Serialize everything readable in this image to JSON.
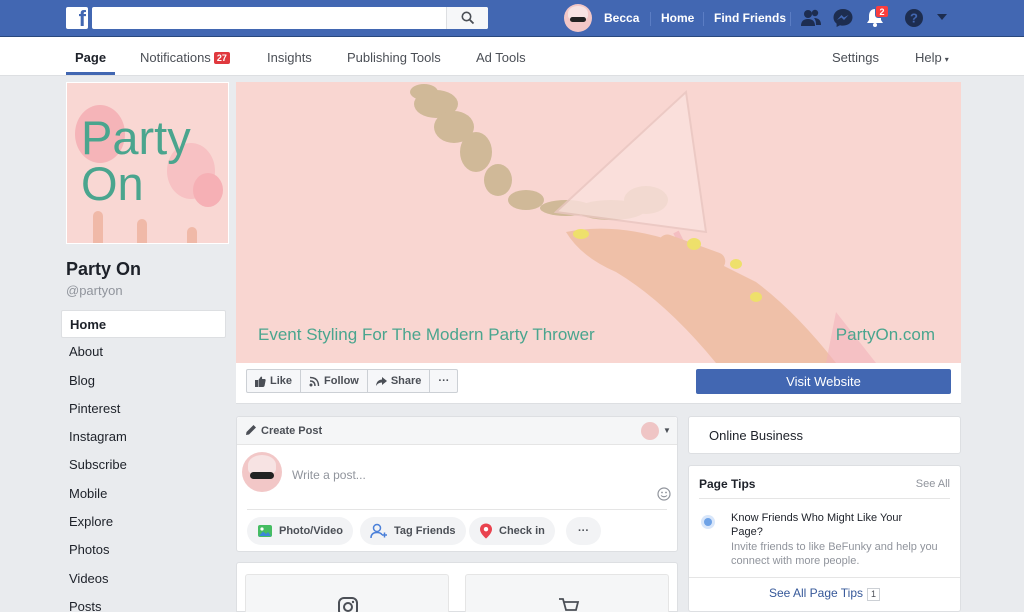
{
  "topbar": {
    "search_placeholder": "",
    "user_name": "Becca",
    "home_label": "Home",
    "find_friends_label": "Find Friends",
    "notifications_count": "2"
  },
  "page_nav": {
    "tabs": [
      {
        "label": "Page"
      },
      {
        "label": "Notifications",
        "badge": "27"
      },
      {
        "label": "Insights"
      },
      {
        "label": "Publishing Tools"
      },
      {
        "label": "Ad Tools"
      }
    ],
    "settings_label": "Settings",
    "help_label": "Help"
  },
  "profile": {
    "picture_text_line1": "Party",
    "picture_text_line2": "On",
    "name": "Party On",
    "handle": "@partyon"
  },
  "sidebar": {
    "items": [
      {
        "label": "Home"
      },
      {
        "label": "About"
      },
      {
        "label": "Blog"
      },
      {
        "label": "Pinterest"
      },
      {
        "label": "Instagram"
      },
      {
        "label": "Subscribe"
      },
      {
        "label": "Mobile"
      },
      {
        "label": "Explore"
      },
      {
        "label": "Photos"
      },
      {
        "label": "Videos"
      },
      {
        "label": "Posts"
      }
    ]
  },
  "cover": {
    "tagline": "Event Styling For The Modern Party Thrower",
    "website_text": "PartyOn.com"
  },
  "actions": {
    "like_label": "Like",
    "follow_label": "Follow",
    "share_label": "Share",
    "more_label": "···",
    "visit_label": "Visit Website"
  },
  "create_post": {
    "title": "Create Post",
    "placeholder": "Write a post...",
    "photo_video_label": "Photo/Video",
    "tag_friends_label": "Tag Friends",
    "check_in_label": "Check in",
    "more_label": "···"
  },
  "right_column": {
    "online_business_label": "Online Business",
    "page_tips_title": "Page Tips",
    "page_tips_see_all": "See All",
    "tip_heading": "Know Friends Who Might Like Your Page?",
    "tip_description": "Invite friends to like BeFunky and help you connect with more people.",
    "see_all_tips_label": "See All Page Tips",
    "see_all_tips_count": "1"
  },
  "colors": {
    "brand_blue": "#4267b2",
    "teal_text": "#4aa58e",
    "cover_pink": "#f9d6d1",
    "badge_red": "#fa3e3e"
  }
}
